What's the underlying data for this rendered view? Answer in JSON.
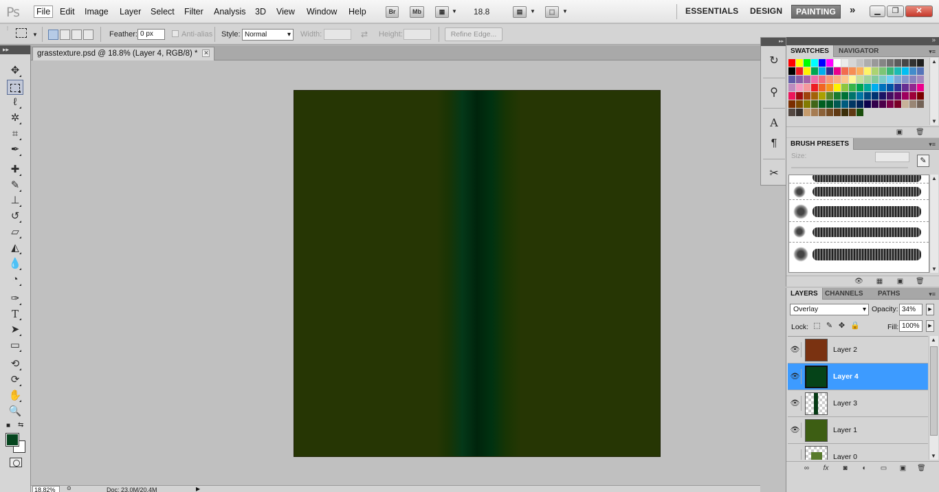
{
  "menubar": {
    "logo": "Ps",
    "menus": [
      "File",
      "Edit",
      "Image",
      "Layer",
      "Select",
      "Filter",
      "Analysis",
      "3D",
      "View",
      "Window",
      "Help"
    ],
    "bridge_label": "Br",
    "minibridge_label": "Mb",
    "zoom": "18.8",
    "workspaces": [
      "ESSENTIALS",
      "DESIGN",
      "PAINTING"
    ],
    "active_workspace": "PAINTING",
    "more_label": "»"
  },
  "options": {
    "feather_label": "Feather:",
    "feather_value": "0 px",
    "antialias_label": "Anti-alias",
    "style_label": "Style:",
    "style_value": "Normal",
    "width_label": "Width:",
    "height_label": "Height:",
    "refine_edge": "Refine Edge..."
  },
  "document": {
    "tab_title": "grasstexture.psd @ 18.8% (Layer 4, RGB/8) *",
    "colors": {
      "base": "#263604",
      "stripe_dark": "#00240c",
      "stripe_mid": "#043818"
    }
  },
  "status": {
    "zoom": "18.82%",
    "doc": "Doc: 23.0M/20.4M"
  },
  "tools": {
    "foreground_color": "#05451e",
    "background_color": "#ffffff",
    "items": [
      "move-icon",
      "marquee-icon",
      "lasso-icon",
      "quick-select-icon",
      "crop-icon",
      "eyedropper-icon",
      "healing-brush-icon",
      "brush-icon",
      "clone-stamp-icon",
      "history-brush-icon",
      "eraser-icon",
      "paint-bucket-icon",
      "blur-icon",
      "dodge-icon",
      "pen-icon",
      "type-icon",
      "path-select-icon",
      "rectangle-icon",
      "3d-rotate-icon",
      "3d-orbit-icon",
      "hand-icon",
      "zoom-icon"
    ]
  },
  "panels": {
    "swatches": {
      "tabs": [
        "SWATCHES",
        "NAVIGATOR"
      ],
      "colors": [
        "#ff0000",
        "#ffff00",
        "#00ff00",
        "#00ffff",
        "#0000ff",
        "#ff00ff",
        "#ffffff",
        "#ebebeb",
        "#d6d6d6",
        "#c2c2c2",
        "#adadad",
        "#999999",
        "#858585",
        "#707070",
        "#5c5c5c",
        "#474747",
        "#333333",
        "#1f1f1f",
        "#000000",
        "#ed1c24",
        "#fff200",
        "#00a651",
        "#00aeef",
        "#2e3192",
        "#ec008c",
        "#f26c4f",
        "#f68e55",
        "#fbaf5c",
        "#fff467",
        "#acd372",
        "#7cc576",
        "#3bb878",
        "#1abbb4",
        "#00bff3",
        "#438ccb",
        "#5574b9",
        "#605ca8",
        "#855fa8",
        "#a763a8",
        "#f06ea9",
        "#f26d7d",
        "#f7977a",
        "#fbad82",
        "#fdc68c",
        "#fff799",
        "#c4df9b",
        "#a3d39c",
        "#82ca9c",
        "#7accc8",
        "#6dcff6",
        "#7da7d8",
        "#8493ca",
        "#8882be",
        "#a187be",
        "#bc8cbf",
        "#f49ac2",
        "#f5989d",
        "#ed1c24",
        "#f26522",
        "#f7941d",
        "#fff200",
        "#8dc63f",
        "#39b54a",
        "#00a651",
        "#00a99d",
        "#00aeef",
        "#0072bc",
        "#0054a6",
        "#2e3192",
        "#662d91",
        "#92278f",
        "#ec008c",
        "#ed145b",
        "#9e0b0f",
        "#a0410d",
        "#a36209",
        "#aba000",
        "#598527",
        "#1a7b30",
        "#007236",
        "#00746b",
        "#0076a3",
        "#004b80",
        "#003471",
        "#1b1464",
        "#440e62",
        "#630460",
        "#9e005d",
        "#9e0039",
        "#790000",
        "#7b2e00",
        "#7d4900",
        "#827b00",
        "#406618",
        "#005e20",
        "#005826",
        "#005952",
        "#005b7f",
        "#003663",
        "#002157",
        "#0d004c",
        "#32004b",
        "#4b0049",
        "#7b0046",
        "#7a0026",
        "#c7b299",
        "#998675",
        "#736357",
        "#534741",
        "#37302d",
        "#c69c6d",
        "#a67c52",
        "#8c6239",
        "#754c24",
        "#603913",
        "#3c2f0a"
      ],
      "recent": [
        "#603913",
        "#1a4d0c"
      ]
    },
    "brushes": {
      "tab": "BRUSH PRESETS",
      "size_label": "Size:"
    },
    "layers": {
      "tabs": [
        "LAYERS",
        "CHANNELS",
        "PATHS"
      ],
      "blend_mode": "Overlay",
      "opacity_label": "Opacity:",
      "opacity": "34%",
      "lock_label": "Lock:",
      "fill_label": "Fill:",
      "fill": "100%",
      "items": [
        {
          "name": "Layer 2",
          "color": "#7a3211",
          "selected": false
        },
        {
          "name": "Layer 4",
          "color": "#054318",
          "selected": true
        },
        {
          "name": "Layer 3",
          "color": "#053a14",
          "selected": false
        },
        {
          "name": "Layer 1",
          "color": "#3d5e13",
          "selected": false
        },
        {
          "name": "Layer 0",
          "color": "#587a2c",
          "selected": false
        }
      ]
    }
  }
}
